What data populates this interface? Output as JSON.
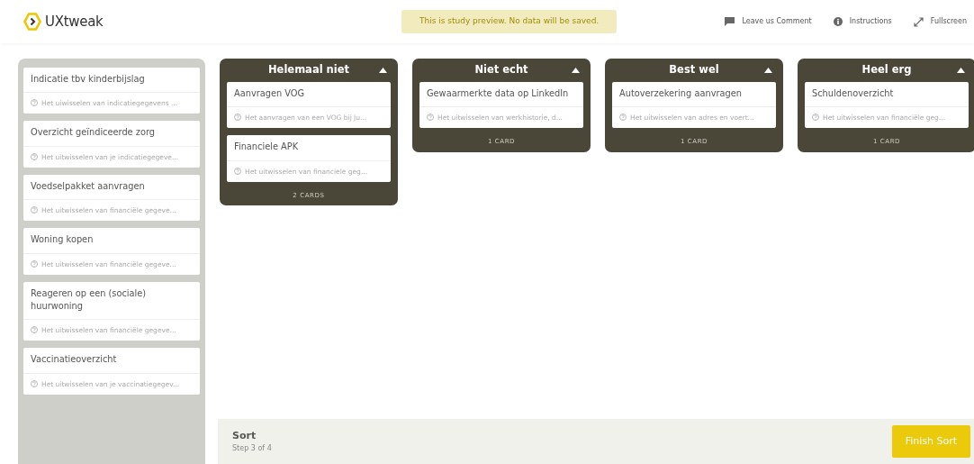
{
  "header": {
    "logo": "UXtweak",
    "notice": "This is study preview. No data will be saved.",
    "actions": [
      {
        "kind": "comment",
        "label": "Leave us Comment"
      },
      {
        "kind": "info",
        "label": "Instructions"
      },
      {
        "kind": "fullscreen",
        "label": "Fullscreen"
      }
    ]
  },
  "unsorted_cards": [
    {
      "title": "Indicatie tbv kinderbijslag",
      "description": "Het uiwisselen van indicatiegegevens ..."
    },
    {
      "title": "Overzicht geïndiceerde zorg",
      "description": "Het uitwisselen van je indicatiegegeve..."
    },
    {
      "title": "Voedselpakket aanvragen",
      "description": "Het uitwisselen van financiële gegeve..."
    },
    {
      "title": "Woning kopen",
      "description": "Het uitwisselen van financiële gegeve..."
    },
    {
      "title": "Reageren op een (sociale) huurwoning",
      "description": "Het uitwisselen van financiële gegeve..."
    },
    {
      "title": "Vaccinatieoverzicht",
      "description": "Het uitwisselen van je vaccinatiegegev..."
    }
  ],
  "categories": [
    {
      "name": "Helemaal niet",
      "count": "2 CARDS",
      "expanded": true,
      "cards": [
        {
          "title": "Aanvragen VOG",
          "description": "Het aanvragen van een VOG bij Ju..."
        },
        {
          "title": "Financiele APK",
          "description": "Het uitwisselen van financiele geg..."
        }
      ]
    },
    {
      "name": "Niet echt",
      "count": "1 CARD",
      "expanded": true,
      "cards": [
        {
          "title": "Gewaarmerkte data op LinkedIn",
          "description": "Het uitwisselen van werkhistorie, d..."
        }
      ]
    },
    {
      "name": "Best wel",
      "count": "1 CARD",
      "expanded": true,
      "cards": [
        {
          "title": "Autoverzekering aanvragen",
          "description": "Het uitwisselen van adres en voert..."
        }
      ]
    },
    {
      "name": "Heel erg",
      "count": "1 CARD",
      "expanded": true,
      "cards": [
        {
          "title": "Schuldenoverzicht",
          "description": "Het uitwisselen van financiële geg..."
        }
      ]
    }
  ],
  "footer": {
    "title": "Sort",
    "step": "Step 3 of 4",
    "button": "Finish Sort"
  }
}
